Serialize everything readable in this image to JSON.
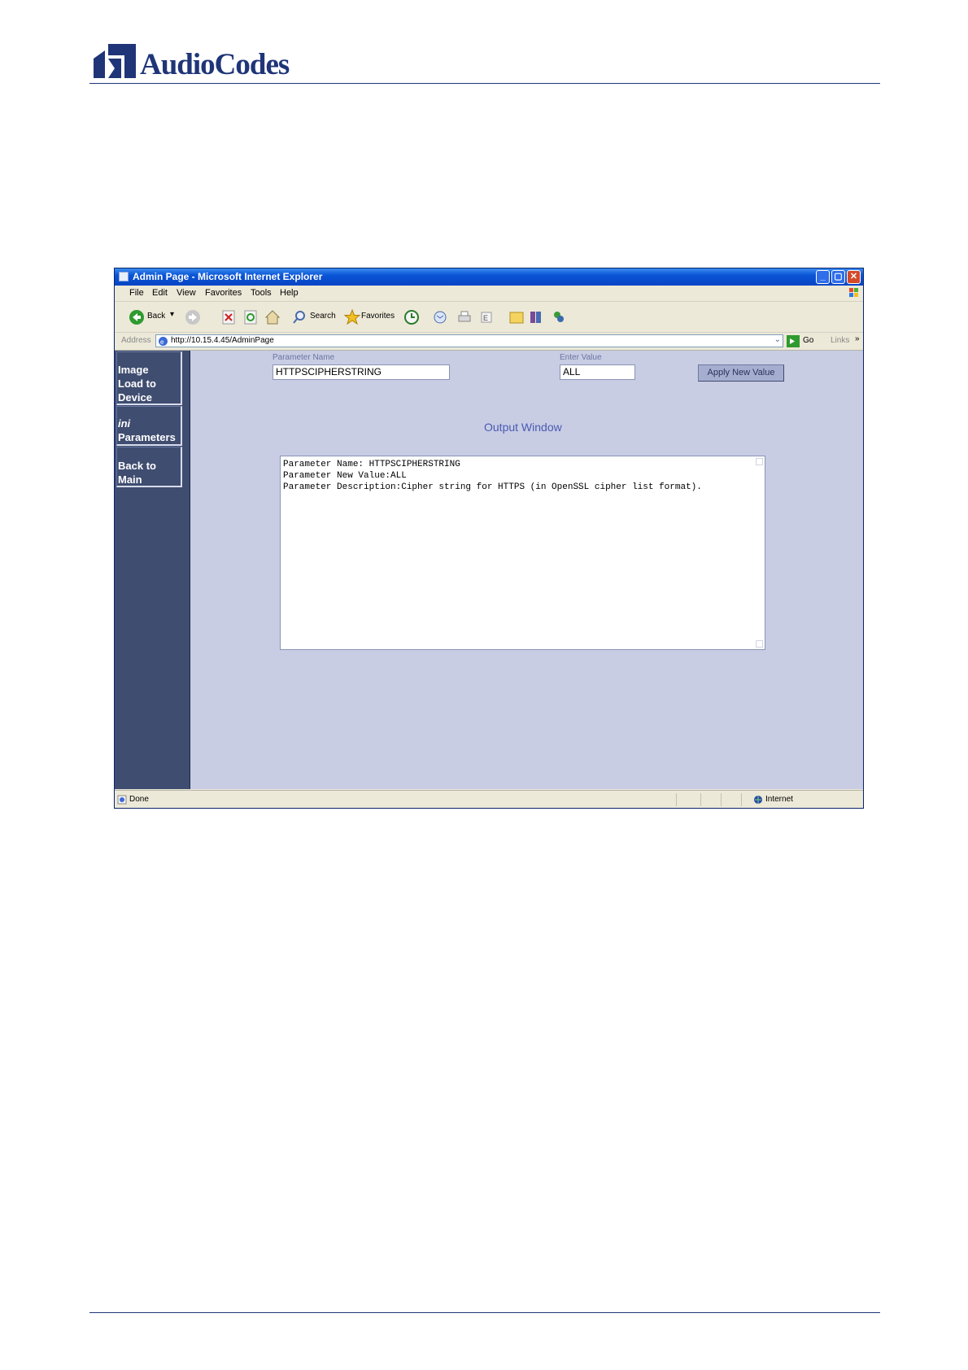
{
  "header": {
    "logo_text": "AudioCodes"
  },
  "window": {
    "title": "Admin Page - Microsoft Internet Explorer",
    "menu": [
      "File",
      "Edit",
      "View",
      "Favorites",
      "Tools",
      "Help"
    ],
    "toolbar": {
      "back": "Back",
      "search": "Search",
      "favorites": "Favorites"
    },
    "address": {
      "label": "Address",
      "url": "http://10.15.4.45/AdminPage",
      "go": "Go",
      "links": "Links"
    },
    "status": {
      "left": "Done",
      "zone": "Internet"
    }
  },
  "page": {
    "sidebar": [
      {
        "lines": [
          "Image",
          "Load to",
          "Device"
        ]
      },
      {
        "lines": [
          "ini",
          "Parameters"
        ]
      },
      {
        "lines": [
          "Back to",
          "Main"
        ]
      }
    ],
    "param_name_label": "Parameter Name",
    "param_name_value": "HTTPSCIPHERSTRING",
    "value_label": "Enter Value",
    "value_value": "ALL",
    "apply_button": "Apply New Value",
    "output_title": "Output Window",
    "output_lines": [
      "Parameter Name: HTTPSCIPHERSTRING",
      "Parameter New Value:ALL",
      "Parameter Description:Cipher string for HTTPS (in OpenSSL cipher list format)."
    ]
  },
  "colors": {
    "brand": "#1f3578",
    "sidebar": "#3f4d70",
    "page_bg": "#c8cde4",
    "titlebar": "#0a54d6"
  }
}
